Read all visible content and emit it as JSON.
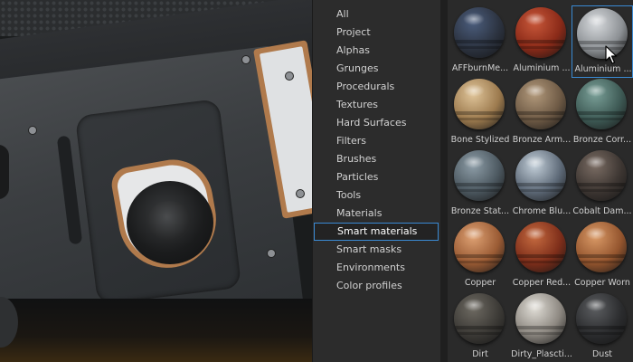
{
  "categories": {
    "items": [
      {
        "label": "All"
      },
      {
        "label": "Project"
      },
      {
        "label": "Alphas"
      },
      {
        "label": "Grunges"
      },
      {
        "label": "Procedurals"
      },
      {
        "label": "Textures"
      },
      {
        "label": "Hard Surfaces"
      },
      {
        "label": "Filters"
      },
      {
        "label": "Brushes"
      },
      {
        "label": "Particles"
      },
      {
        "label": "Tools"
      },
      {
        "label": "Materials"
      },
      {
        "label": "Smart materials"
      },
      {
        "label": "Smart masks"
      },
      {
        "label": "Environments"
      },
      {
        "label": "Color profiles"
      }
    ],
    "selected": "Smart materials"
  },
  "materials": {
    "items": [
      {
        "label": "AFFburnMe...",
        "color": "#2c3340",
        "highlight": "#4b5d7d"
      },
      {
        "label": "Aluminium ...",
        "color": "#8a2a18",
        "highlight": "#c9583a"
      },
      {
        "label": "Aluminium ...",
        "color": "#8d9195",
        "highlight": "#d8dbde",
        "selected": true
      },
      {
        "label": "Bone Stylized",
        "color": "#9c7a4e",
        "highlight": "#e0c59a"
      },
      {
        "label": "Bronze Arm...",
        "color": "#6e5a45",
        "highlight": "#b39a7c"
      },
      {
        "label": "Bronze Corr...",
        "color": "#3e5a55",
        "highlight": "#7aa098"
      },
      {
        "label": "Bronze Stat...",
        "color": "#4c5860",
        "highlight": "#8e9ea8"
      },
      {
        "label": "Chrome Blu...",
        "color": "#5e6a78",
        "highlight": "#c3cfd9"
      },
      {
        "label": "Cobalt Dam...",
        "color": "#3d3632",
        "highlight": "#7b6d64"
      },
      {
        "label": "Copper",
        "color": "#9a5b34",
        "highlight": "#dea173"
      },
      {
        "label": "Copper Red...",
        "color": "#7e2e1a",
        "highlight": "#c56a3f"
      },
      {
        "label": "Copper Worn",
        "color": "#94552e",
        "highlight": "#d99966"
      },
      {
        "label": "Dirt",
        "color": "#3c3a36",
        "highlight": "#6e6a62"
      },
      {
        "label": "Dirty_Plascti...",
        "color": "#8c8780",
        "highlight": "#e0ddd6"
      },
      {
        "label": "Dust",
        "color": "#2b2c2e",
        "highlight": "#5c5e61"
      }
    ]
  }
}
